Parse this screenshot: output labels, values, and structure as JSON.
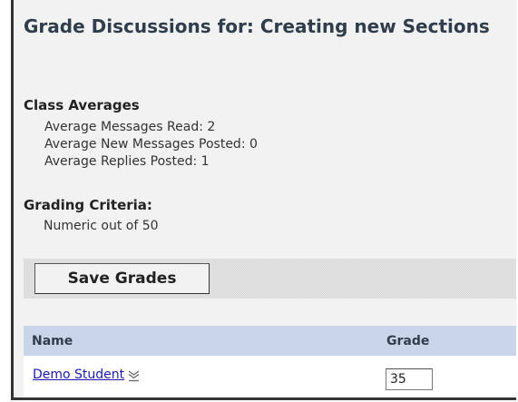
{
  "page": {
    "title": "Grade Discussions for: Creating new Sections"
  },
  "class_averages": {
    "heading": "Class Averages",
    "messages_read": "Average Messages Read: 2",
    "new_messages_posted": "Average New Messages Posted: 0",
    "replies_posted": "Average Replies Posted: 1"
  },
  "grading_criteria": {
    "heading": "Grading Criteria:",
    "value": "Numeric out of 50"
  },
  "toolbar": {
    "save_label": "Save Grades"
  },
  "table": {
    "columns": {
      "name": "Name",
      "grade": "Grade"
    },
    "rows": [
      {
        "name": "Demo Student",
        "grade": "35",
        "menu_icon": "drop-down-menu-icon"
      }
    ]
  }
}
